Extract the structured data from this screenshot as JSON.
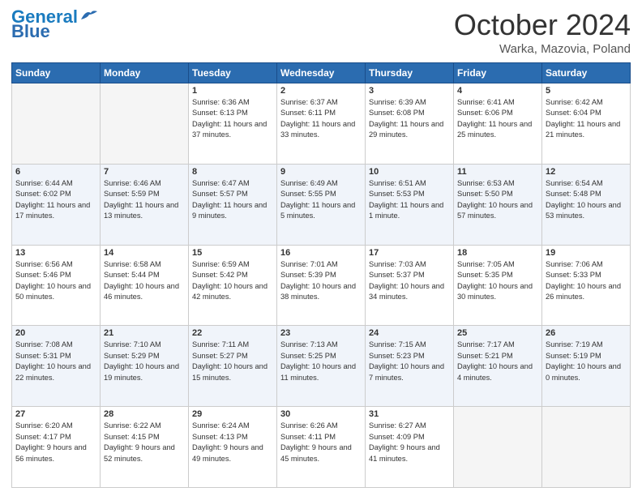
{
  "header": {
    "logo_line1": "General",
    "logo_line2": "Blue",
    "month": "October 2024",
    "location": "Warka, Mazovia, Poland"
  },
  "days_of_week": [
    "Sunday",
    "Monday",
    "Tuesday",
    "Wednesday",
    "Thursday",
    "Friday",
    "Saturday"
  ],
  "weeks": [
    [
      {
        "day": "",
        "detail": ""
      },
      {
        "day": "",
        "detail": ""
      },
      {
        "day": "1",
        "detail": "Sunrise: 6:36 AM\nSunset: 6:13 PM\nDaylight: 11 hours and 37 minutes."
      },
      {
        "day": "2",
        "detail": "Sunrise: 6:37 AM\nSunset: 6:11 PM\nDaylight: 11 hours and 33 minutes."
      },
      {
        "day": "3",
        "detail": "Sunrise: 6:39 AM\nSunset: 6:08 PM\nDaylight: 11 hours and 29 minutes."
      },
      {
        "day": "4",
        "detail": "Sunrise: 6:41 AM\nSunset: 6:06 PM\nDaylight: 11 hours and 25 minutes."
      },
      {
        "day": "5",
        "detail": "Sunrise: 6:42 AM\nSunset: 6:04 PM\nDaylight: 11 hours and 21 minutes."
      }
    ],
    [
      {
        "day": "6",
        "detail": "Sunrise: 6:44 AM\nSunset: 6:02 PM\nDaylight: 11 hours and 17 minutes."
      },
      {
        "day": "7",
        "detail": "Sunrise: 6:46 AM\nSunset: 5:59 PM\nDaylight: 11 hours and 13 minutes."
      },
      {
        "day": "8",
        "detail": "Sunrise: 6:47 AM\nSunset: 5:57 PM\nDaylight: 11 hours and 9 minutes."
      },
      {
        "day": "9",
        "detail": "Sunrise: 6:49 AM\nSunset: 5:55 PM\nDaylight: 11 hours and 5 minutes."
      },
      {
        "day": "10",
        "detail": "Sunrise: 6:51 AM\nSunset: 5:53 PM\nDaylight: 11 hours and 1 minute."
      },
      {
        "day": "11",
        "detail": "Sunrise: 6:53 AM\nSunset: 5:50 PM\nDaylight: 10 hours and 57 minutes."
      },
      {
        "day": "12",
        "detail": "Sunrise: 6:54 AM\nSunset: 5:48 PM\nDaylight: 10 hours and 53 minutes."
      }
    ],
    [
      {
        "day": "13",
        "detail": "Sunrise: 6:56 AM\nSunset: 5:46 PM\nDaylight: 10 hours and 50 minutes."
      },
      {
        "day": "14",
        "detail": "Sunrise: 6:58 AM\nSunset: 5:44 PM\nDaylight: 10 hours and 46 minutes."
      },
      {
        "day": "15",
        "detail": "Sunrise: 6:59 AM\nSunset: 5:42 PM\nDaylight: 10 hours and 42 minutes."
      },
      {
        "day": "16",
        "detail": "Sunrise: 7:01 AM\nSunset: 5:39 PM\nDaylight: 10 hours and 38 minutes."
      },
      {
        "day": "17",
        "detail": "Sunrise: 7:03 AM\nSunset: 5:37 PM\nDaylight: 10 hours and 34 minutes."
      },
      {
        "day": "18",
        "detail": "Sunrise: 7:05 AM\nSunset: 5:35 PM\nDaylight: 10 hours and 30 minutes."
      },
      {
        "day": "19",
        "detail": "Sunrise: 7:06 AM\nSunset: 5:33 PM\nDaylight: 10 hours and 26 minutes."
      }
    ],
    [
      {
        "day": "20",
        "detail": "Sunrise: 7:08 AM\nSunset: 5:31 PM\nDaylight: 10 hours and 22 minutes."
      },
      {
        "day": "21",
        "detail": "Sunrise: 7:10 AM\nSunset: 5:29 PM\nDaylight: 10 hours and 19 minutes."
      },
      {
        "day": "22",
        "detail": "Sunrise: 7:11 AM\nSunset: 5:27 PM\nDaylight: 10 hours and 15 minutes."
      },
      {
        "day": "23",
        "detail": "Sunrise: 7:13 AM\nSunset: 5:25 PM\nDaylight: 10 hours and 11 minutes."
      },
      {
        "day": "24",
        "detail": "Sunrise: 7:15 AM\nSunset: 5:23 PM\nDaylight: 10 hours and 7 minutes."
      },
      {
        "day": "25",
        "detail": "Sunrise: 7:17 AM\nSunset: 5:21 PM\nDaylight: 10 hours and 4 minutes."
      },
      {
        "day": "26",
        "detail": "Sunrise: 7:19 AM\nSunset: 5:19 PM\nDaylight: 10 hours and 0 minutes."
      }
    ],
    [
      {
        "day": "27",
        "detail": "Sunrise: 6:20 AM\nSunset: 4:17 PM\nDaylight: 9 hours and 56 minutes."
      },
      {
        "day": "28",
        "detail": "Sunrise: 6:22 AM\nSunset: 4:15 PM\nDaylight: 9 hours and 52 minutes."
      },
      {
        "day": "29",
        "detail": "Sunrise: 6:24 AM\nSunset: 4:13 PM\nDaylight: 9 hours and 49 minutes."
      },
      {
        "day": "30",
        "detail": "Sunrise: 6:26 AM\nSunset: 4:11 PM\nDaylight: 9 hours and 45 minutes."
      },
      {
        "day": "31",
        "detail": "Sunrise: 6:27 AM\nSunset: 4:09 PM\nDaylight: 9 hours and 41 minutes."
      },
      {
        "day": "",
        "detail": ""
      },
      {
        "day": "",
        "detail": ""
      }
    ]
  ]
}
